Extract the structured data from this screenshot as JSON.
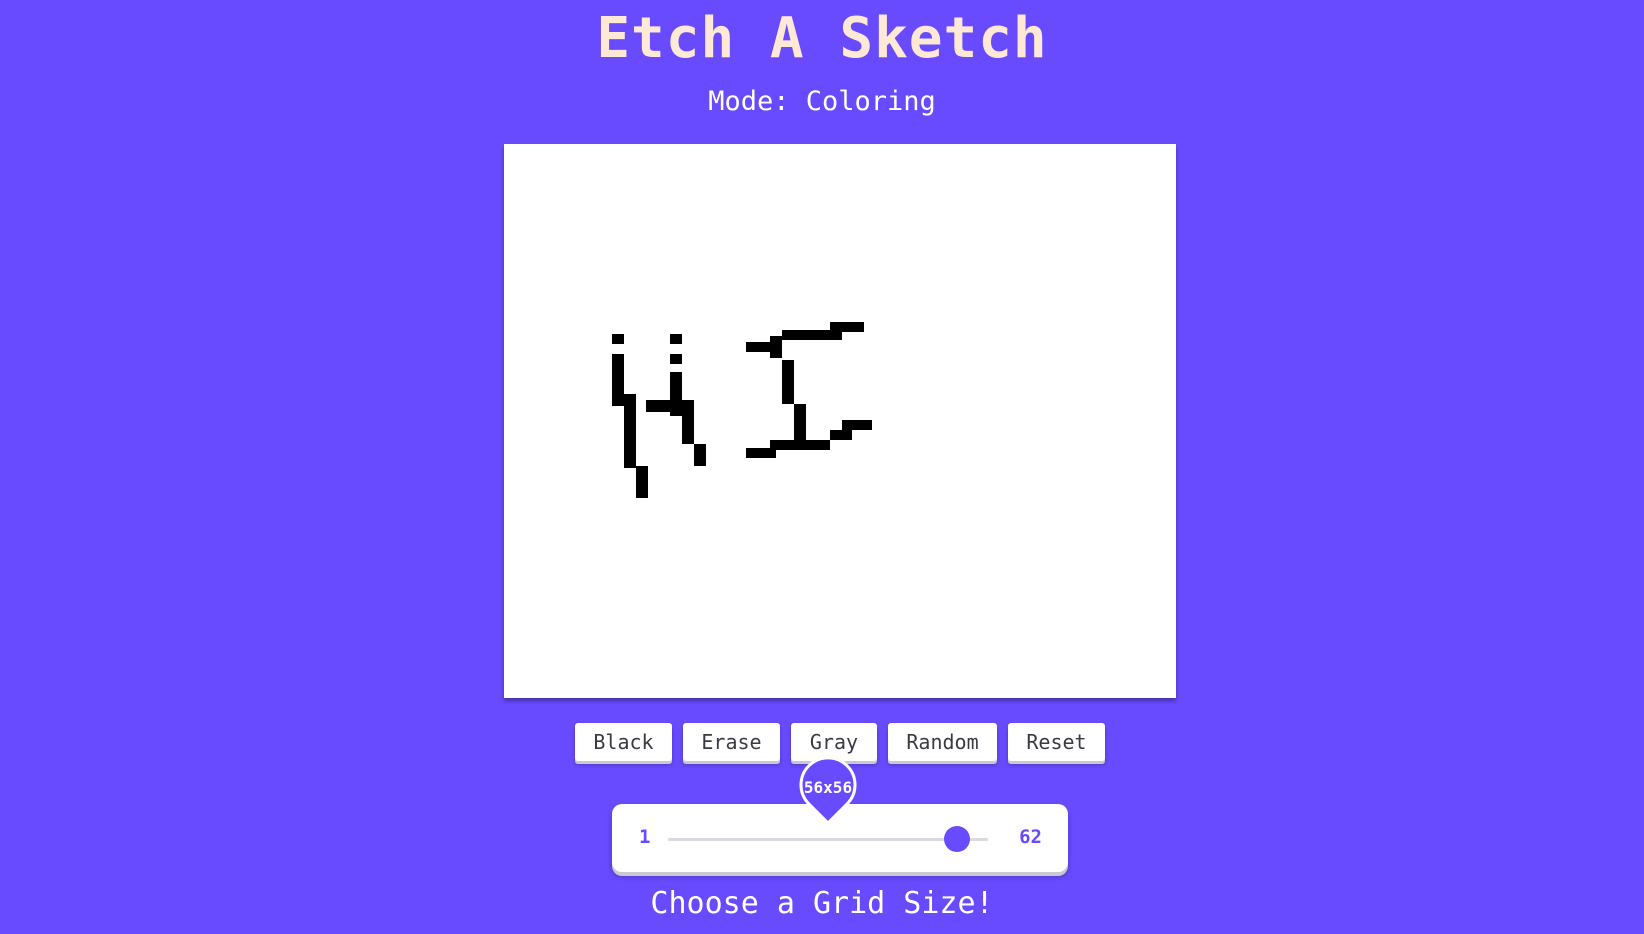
{
  "header": {
    "title": "Etch A Sketch",
    "mode_label": "Mode: Coloring"
  },
  "colors": {
    "background": "#684bff",
    "title": "#fde9d6",
    "ink": "#000000",
    "canvas": "#ffffff"
  },
  "controls": {
    "buttons": [
      "Black",
      "Erase",
      "Gray",
      "Random",
      "Reset"
    ]
  },
  "slider": {
    "min": "1",
    "max": "62",
    "value": 56,
    "value_label": "56x56"
  },
  "footer": {
    "caption": "Choose a Grid Size!"
  }
}
